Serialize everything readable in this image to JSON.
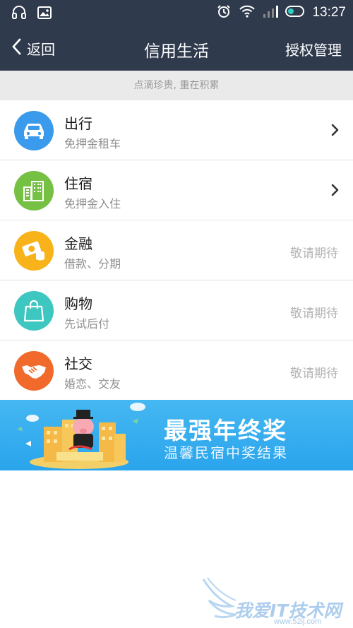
{
  "status_bar": {
    "time": "13:27"
  },
  "nav": {
    "back_label": "返回",
    "title": "信用生活",
    "action_label": "授权管理"
  },
  "tagline": "点滴珍贵, 重在积累",
  "items": [
    {
      "title": "出行",
      "subtitle": "免押金租车",
      "icon": "car-icon",
      "color": "#3a9bec"
    },
    {
      "title": "住宿",
      "subtitle": "免押金入住",
      "icon": "building-icon",
      "color": "#76c043"
    },
    {
      "title": "金融",
      "subtitle": "借款、分期",
      "status": "敬请期待",
      "icon": "money-icon",
      "color": "#f7b319"
    },
    {
      "title": "购物",
      "subtitle": "先试后付",
      "status": "敬请期待",
      "icon": "shopping-bag-icon",
      "color": "#3ec7c1"
    },
    {
      "title": "社交",
      "subtitle": "婚恋、交友",
      "status": "敬请期待",
      "icon": "handshake-icon",
      "color": "#f26a2b"
    }
  ],
  "banner": {
    "title": "最强年终奖",
    "subtitle": "温馨民宿中奖结果"
  },
  "watermark": {
    "text": "我爱IT技术网",
    "url": "www.52ij.com"
  }
}
